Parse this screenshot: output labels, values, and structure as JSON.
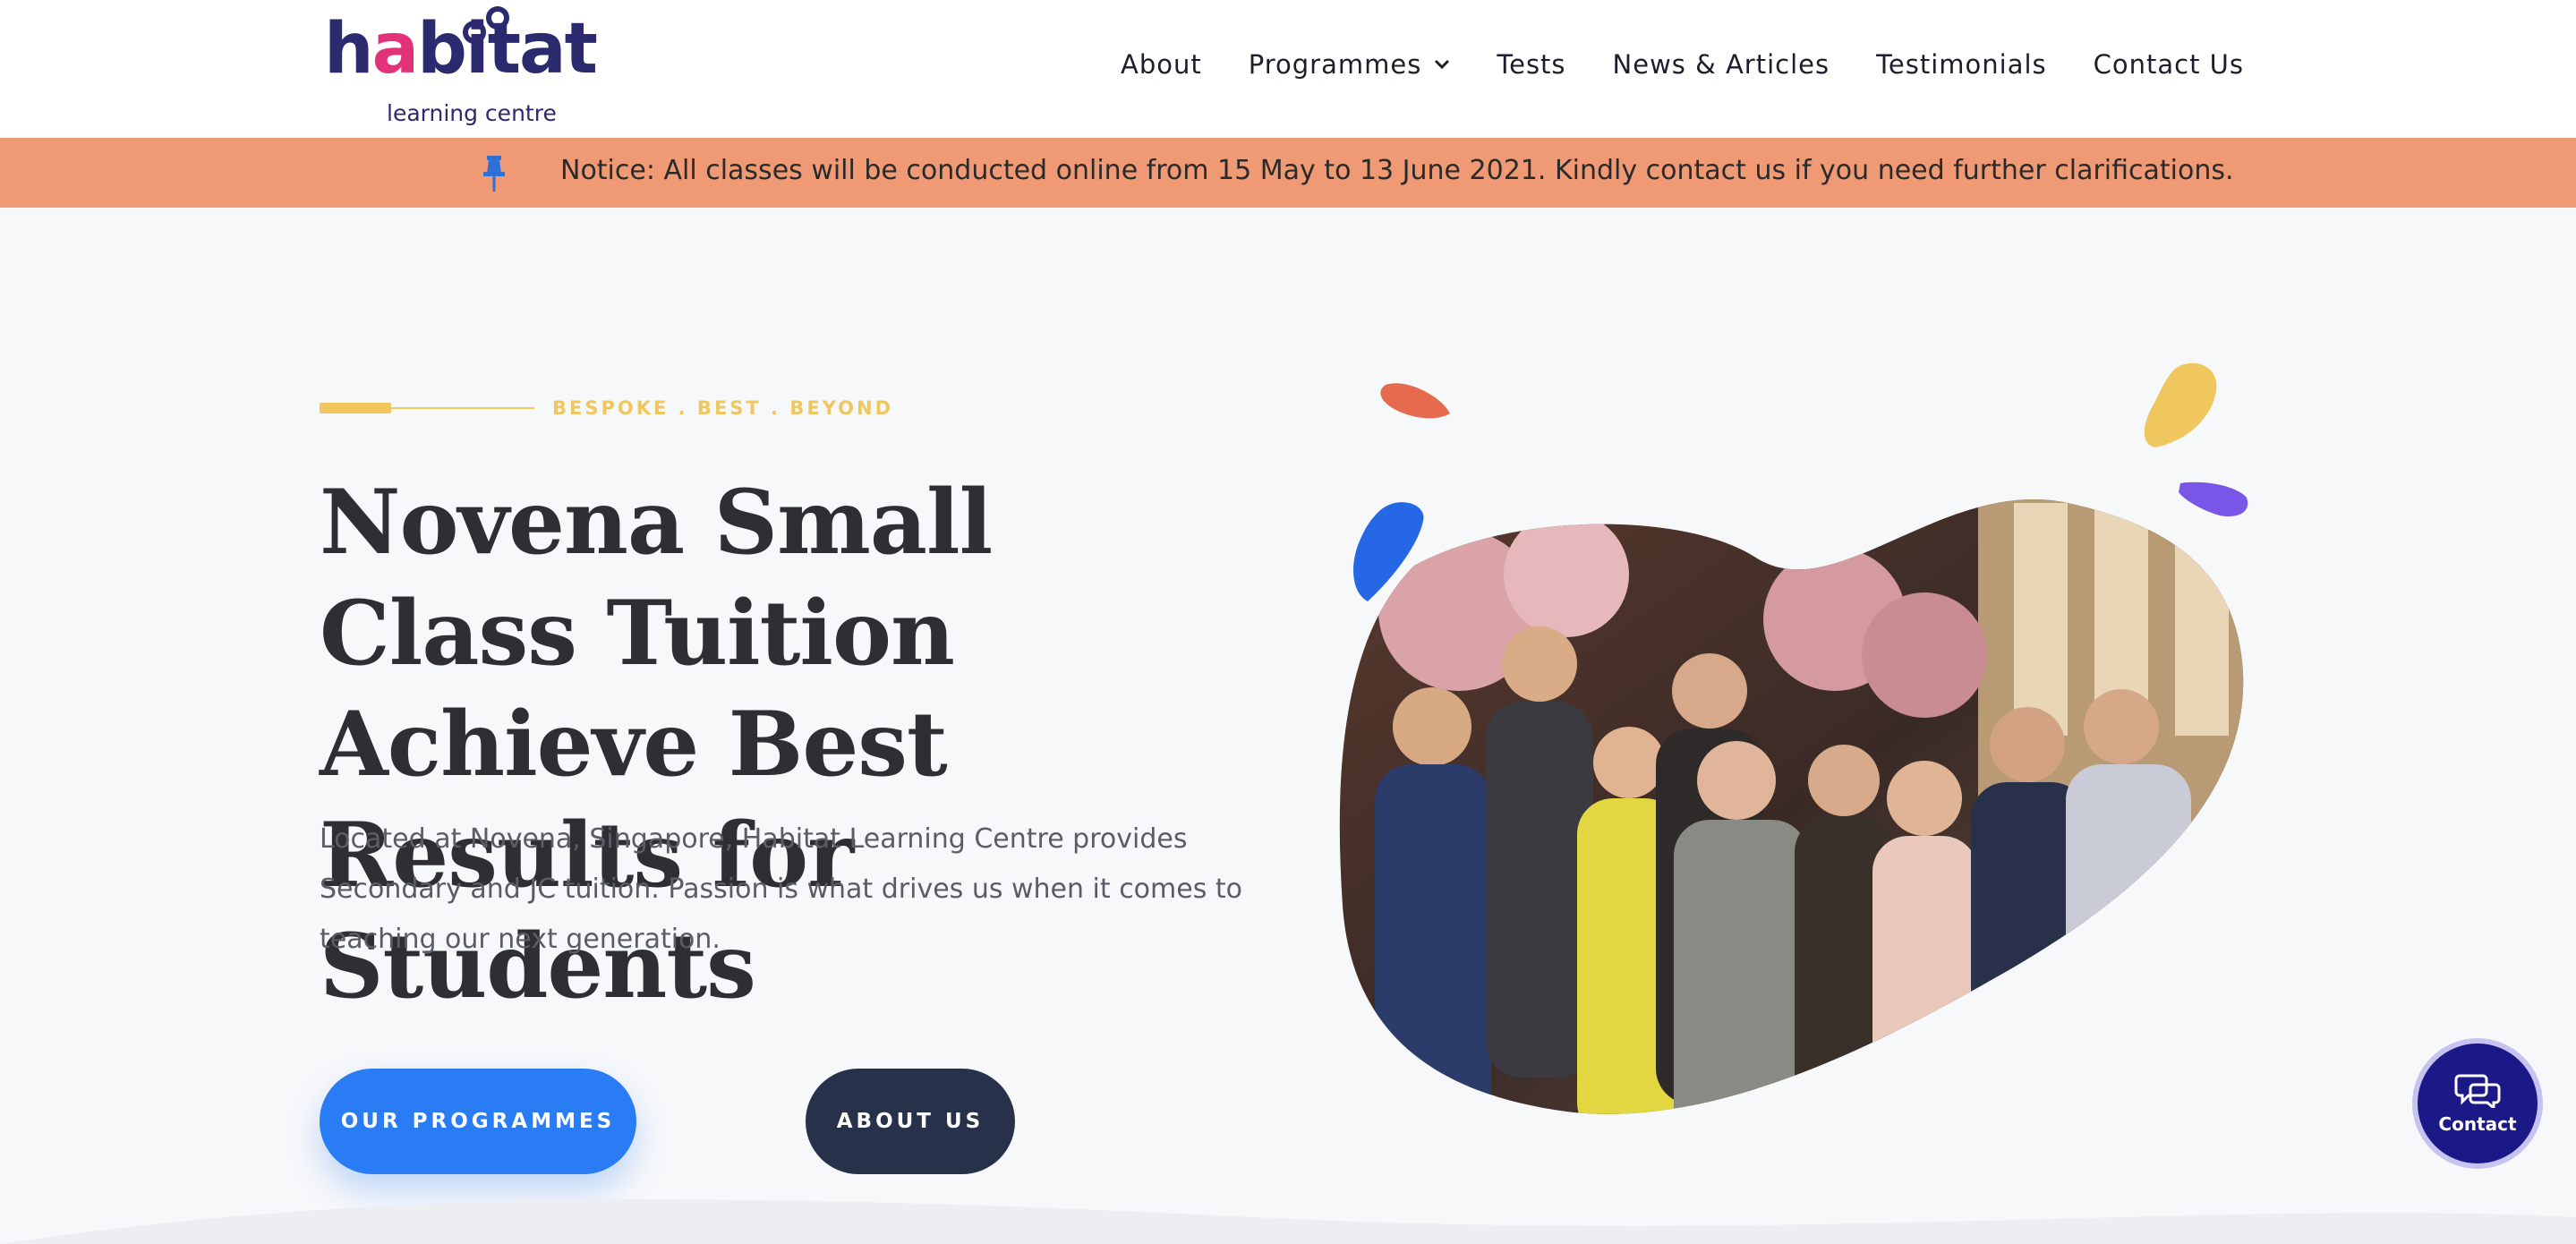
{
  "header": {
    "logo": {
      "word_part1": "h",
      "word_accent": "a",
      "word_part2": "bitat",
      "subtitle": "learning centre"
    },
    "nav": [
      {
        "label": "About"
      },
      {
        "label": "Programmes",
        "has_dropdown": true
      },
      {
        "label": "Tests"
      },
      {
        "label": "News & Articles"
      },
      {
        "label": "Testimonials"
      },
      {
        "label": "Contact Us"
      }
    ]
  },
  "notice": {
    "icon": "pushpin-icon",
    "text": "Notice: All classes will be conducted online from 15 May to 13 June 2021. Kindly contact us if you need further clarifications."
  },
  "hero": {
    "tagline": "BESPOKE . BEST . BEYOND",
    "headline": "Novena Small Class Tuition Achieve Best Results for Students",
    "intro": "Located at Novena, Singapore, Habitat Learning Centre provides Secondary and JC tuition. Passion is what drives us when it comes to teaching our next generation.",
    "buttons": {
      "programmes": "OUR PROGRAMMES",
      "about": "ABOUT US"
    },
    "image": "team-group-photo"
  },
  "contact_fab": {
    "icon": "chat-bubbles-icon",
    "label": "Contact"
  },
  "colors": {
    "brand_navy": "#2b2a6e",
    "brand_pink": "#e2337a",
    "notice_bg": "#ef9a74",
    "accent_yellow": "#f0c75e",
    "primary_blue": "#2a7cf5",
    "dark_button": "#27324a",
    "fab_bg": "#1b1888"
  }
}
